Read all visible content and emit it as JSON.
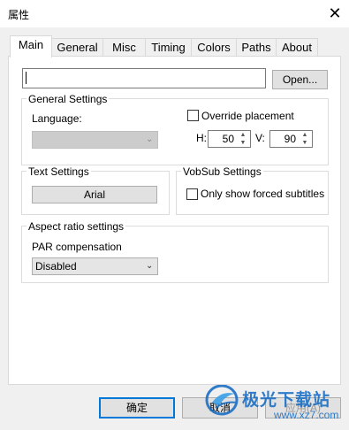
{
  "window": {
    "title": "属性",
    "close_glyph": "✕"
  },
  "tabs": [
    "Main",
    "General",
    "Misc",
    "Timing",
    "Colors",
    "Paths",
    "About"
  ],
  "main": {
    "path_value": "",
    "open_label": "Open...",
    "general_settings": {
      "label": "General Settings",
      "language_label": "Language:",
      "language_value": "",
      "override_label": "Override placement",
      "override_checked": false,
      "h_label": "H:",
      "h_value": "50",
      "v_label": "V:",
      "v_value": "90"
    },
    "text_settings": {
      "label": "Text Settings",
      "font_button": "Arial"
    },
    "vobsub_settings": {
      "label": "VobSub Settings",
      "forced_label": "Only show forced subtitles",
      "forced_checked": false
    },
    "aspect": {
      "label": "Aspect ratio settings",
      "par_label": "PAR compensation",
      "par_value": "Disabled"
    }
  },
  "footer": {
    "ok": "确定",
    "cancel": "取消",
    "apply": "应用(A)"
  },
  "watermark": {
    "brand": "极光下载站",
    "url": "www.xz7.com"
  },
  "colors": {
    "accent": "#0078d7",
    "watermark": "#1b6fc5"
  }
}
